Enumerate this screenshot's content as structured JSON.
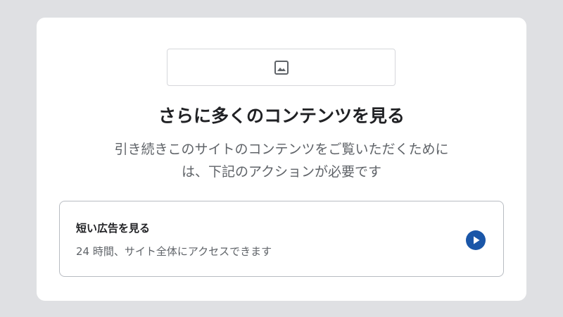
{
  "dialog": {
    "image_icon": "image-icon",
    "title": "さらに多くのコンテンツを見る",
    "subtitle_line1": "引き続きこのサイトのコンテンツをご覧いただくために",
    "subtitle_line2": "は、下記のアクションが必要です",
    "option": {
      "title": "短い広告を見る",
      "description": "24 時間、サイト全体にアクセスできます",
      "icon": "play-circle-icon",
      "accent_color": "#1a56a8"
    }
  },
  "colors": {
    "page_background": "#dfe0e3",
    "card_background": "#ffffff",
    "title_text": "#202124",
    "secondary_text": "#5f6368"
  }
}
